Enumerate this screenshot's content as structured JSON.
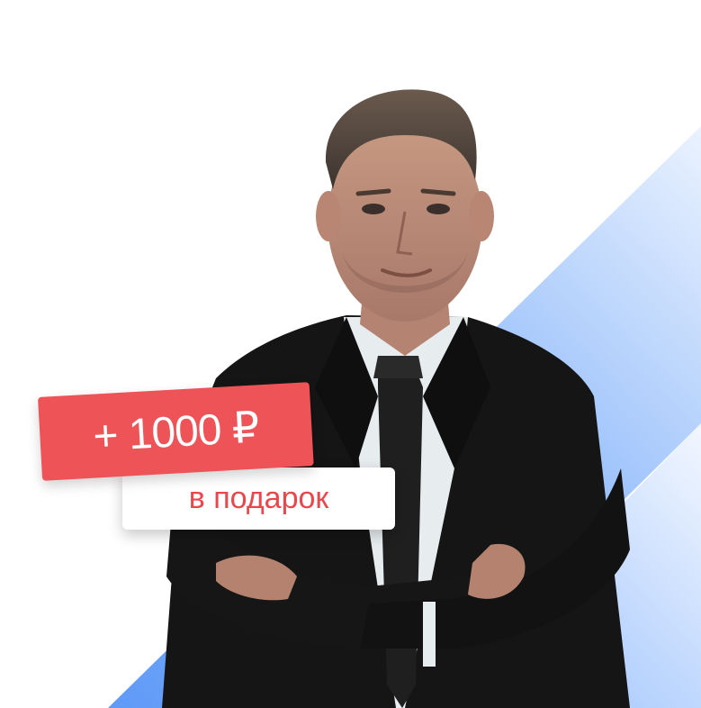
{
  "promo": {
    "amount_label": "+ 1000 ₽",
    "subtitle": "в подарок"
  },
  "colors": {
    "accent_red": "#ee5358",
    "text_red": "#e8474c",
    "stripe_blue": "#7fb0fb",
    "suit": "#141414",
    "shirt": "#e9eef2"
  },
  "image": {
    "subject": "man-in-suit-photo"
  }
}
